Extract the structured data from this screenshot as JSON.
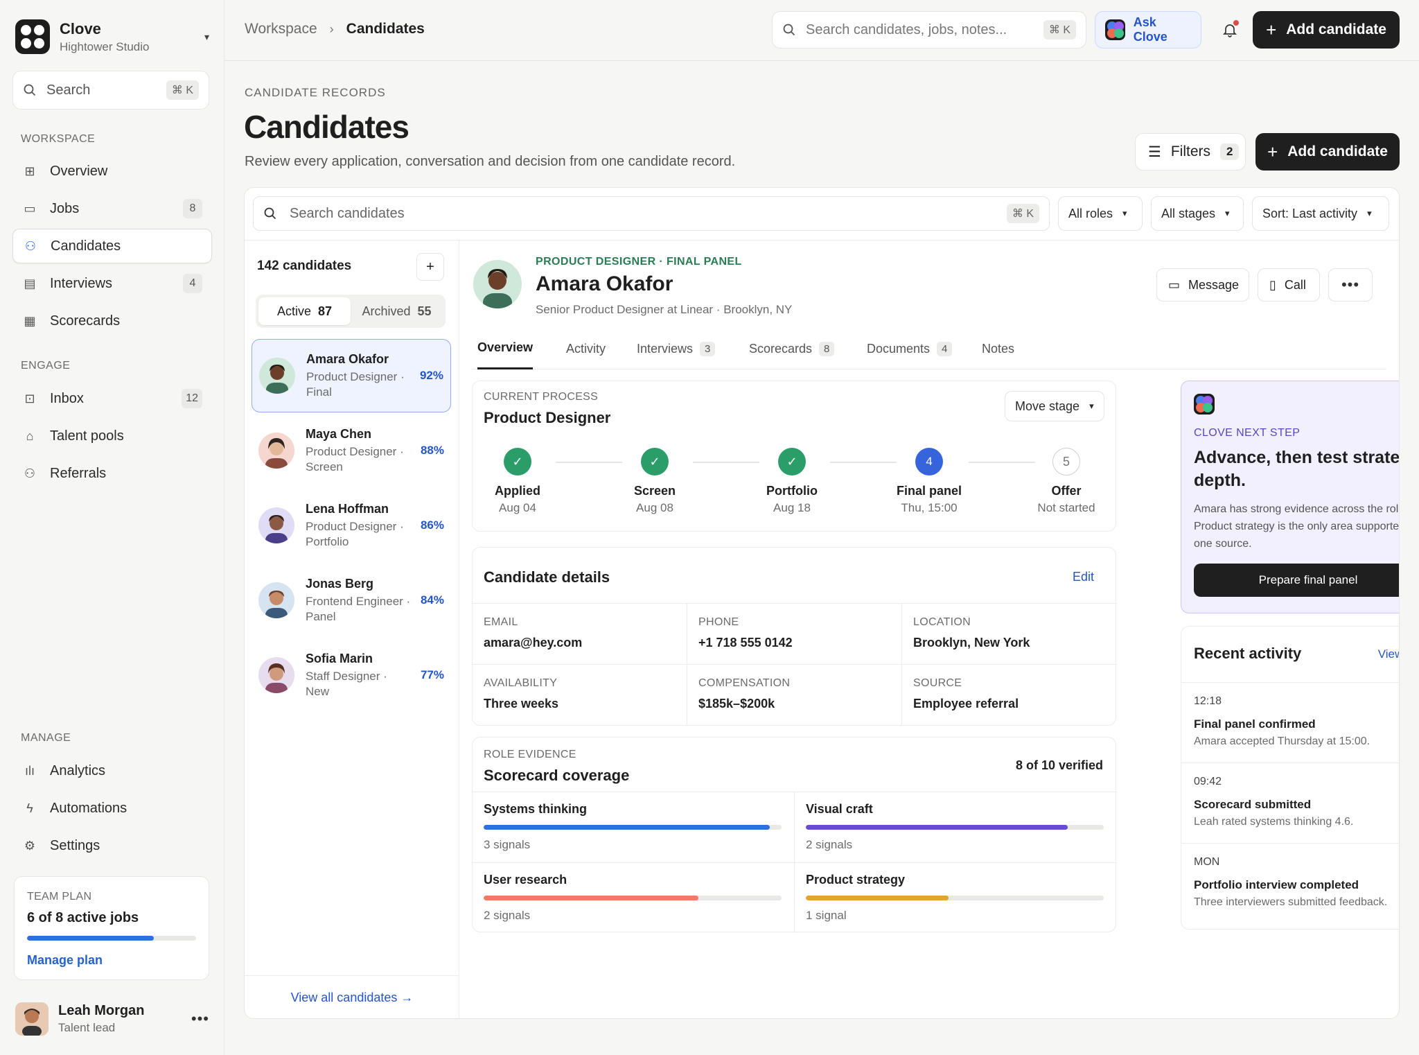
{
  "workspace": {
    "name": "Clove",
    "subtitle": "Hightower Studio"
  },
  "sidebar": {
    "search_label": "Search",
    "shortcut": "⌘ K",
    "sections": {
      "workspace": "WORKSPACE",
      "engage": "ENGAGE",
      "manage": "MANAGE"
    },
    "items": [
      {
        "label": "Overview",
        "count": ""
      },
      {
        "label": "Jobs",
        "count": "8"
      },
      {
        "label": "Candidates",
        "count": ""
      },
      {
        "label": "Interviews",
        "count": "4"
      },
      {
        "label": "Scorecards",
        "count": ""
      },
      {
        "label": "Inbox",
        "count": "12"
      },
      {
        "label": "Talent pools",
        "count": ""
      },
      {
        "label": "Referrals",
        "count": ""
      },
      {
        "label": "Analytics",
        "count": ""
      },
      {
        "label": "Automations",
        "count": ""
      },
      {
        "label": "Settings",
        "count": ""
      }
    ],
    "plan": {
      "title": "TEAM PLAN",
      "value": "6 of 8 active jobs",
      "progress": 0.75,
      "link": "Manage plan"
    },
    "user": {
      "name": "Leah Morgan",
      "role": "Talent lead"
    }
  },
  "topbar": {
    "breadcrumb": [
      "Workspace",
      "Candidates"
    ],
    "search_placeholder": "Search candidates, jobs, notes...",
    "shortcut": "⌘ K",
    "ask_label": "Ask Clove",
    "add_label": "Add candidate"
  },
  "page": {
    "eyebrow": "CANDIDATE RECORDS",
    "title": "Candidates",
    "subtitle": "Review every application, conversation and decision from one candidate record.",
    "filters_label": "Filters",
    "filters_count": "2",
    "add_label": "Add candidate"
  },
  "filterbar": {
    "search_placeholder": "Search candidates",
    "shortcut": "⌘ K",
    "roles": "All roles",
    "stages": "All stages",
    "sort": "Sort: Last activity"
  },
  "list": {
    "count_label": "142 candidates",
    "tabs": [
      {
        "label": "Active",
        "count": "87"
      },
      {
        "label": "Archived",
        "count": "55"
      }
    ],
    "candidates": [
      {
        "name": "Amara Okafor",
        "role": "Product Designer ·",
        "stage": "Final",
        "score": "92%"
      },
      {
        "name": "Maya Chen",
        "role": "Product Designer ·",
        "stage": "Screen",
        "score": "88%"
      },
      {
        "name": "Lena Hoffman",
        "role": "Product Designer ·",
        "stage": "Portfolio",
        "score": "86%"
      },
      {
        "name": "Jonas Berg",
        "role": "Frontend Engineer ·",
        "stage": "Panel",
        "score": "84%"
      },
      {
        "name": "Sofia Marin",
        "role": "Staff Designer ·",
        "stage": "New",
        "score": "77%"
      }
    ],
    "view_all": "View all candidates →"
  },
  "detail": {
    "role_line": "PRODUCT DESIGNER · FINAL PANEL",
    "name": "Amara Okafor",
    "subline": "Senior Product Designer at Linear · Brooklyn, NY",
    "message_label": "Message",
    "call_label": "Call",
    "tabs": [
      {
        "label": "Overview",
        "count": ""
      },
      {
        "label": "Activity",
        "count": ""
      },
      {
        "label": "Interviews",
        "count": "3"
      },
      {
        "label": "Scorecards",
        "count": "8"
      },
      {
        "label": "Documents",
        "count": "4"
      },
      {
        "label": "Notes",
        "count": ""
      }
    ],
    "process": {
      "eyebrow": "CURRENT PROCESS",
      "title": "Product Designer",
      "move_label": "Move stage",
      "steps": [
        {
          "name": "Applied",
          "date": "Aug 04",
          "status": "done",
          "num": ""
        },
        {
          "name": "Screen",
          "date": "Aug 08",
          "status": "done",
          "num": ""
        },
        {
          "name": "Portfolio",
          "date": "Aug 18",
          "status": "done",
          "num": ""
        },
        {
          "name": "Final panel",
          "date": "Thu, 15:00",
          "status": "current",
          "num": "4"
        },
        {
          "name": "Offer",
          "date": "Not started",
          "status": "todo",
          "num": "5"
        }
      ]
    },
    "details": {
      "title": "Candidate details",
      "edit_label": "Edit",
      "fields": [
        {
          "label": "EMAIL",
          "value": "amara@hey.com"
        },
        {
          "label": "PHONE",
          "value": "+1 718 555 0142"
        },
        {
          "label": "LOCATION",
          "value": "Brooklyn, New York"
        },
        {
          "label": "AVAILABILITY",
          "value": "Three weeks"
        },
        {
          "label": "COMPENSATION",
          "value": "$185k–$200k"
        },
        {
          "label": "SOURCE",
          "value": "Employee referral"
        }
      ]
    },
    "scorecard": {
      "eyebrow": "ROLE EVIDENCE",
      "title": "Scorecard coverage",
      "verified": "8 of 10 verified",
      "items": [
        {
          "name": "Systems thinking",
          "signals": "3 signals",
          "level": 0.96,
          "color": "#2f6fe0"
        },
        {
          "name": "Visual craft",
          "signals": "2 signals",
          "level": 0.88,
          "color": "#6a4bd6"
        },
        {
          "name": "User research",
          "signals": "2 signals",
          "level": 0.72,
          "color": "#f07a64"
        },
        {
          "name": "Product strategy",
          "signals": "1 signal",
          "level": 0.48,
          "color": "#e0a52c"
        }
      ]
    }
  },
  "next_step": {
    "eyebrow": "CLOVE NEXT STEP",
    "title": "Advance, then test strategy depth.",
    "body": "Amara has strong evidence across the role. Product strategy is the only area supported by one source.",
    "button": "Prepare final panel"
  },
  "recent_activity": {
    "title": "Recent activity",
    "view_all": "View all",
    "items": [
      {
        "time": "12:18",
        "title": "Final panel confirmed",
        "desc": "Amara accepted Thursday at 15:00."
      },
      {
        "time": "09:42",
        "title": "Scorecard submitted",
        "desc": "Leah rated systems thinking 4.6."
      },
      {
        "time": "MON",
        "title": "Portfolio interview completed",
        "desc": "Three interviewers submitted feedback."
      }
    ]
  }
}
